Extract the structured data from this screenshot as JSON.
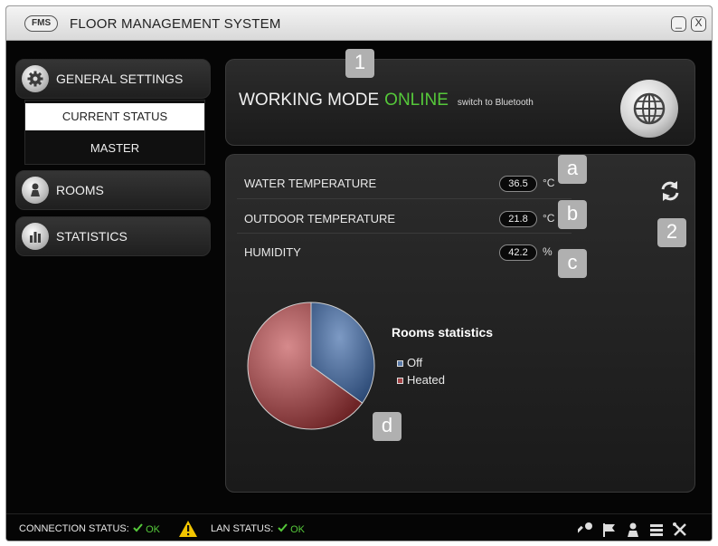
{
  "window": {
    "logo": "FMS",
    "title": "FLOOR MANAGEMENT SYSTEM",
    "minimize_glyph": "_",
    "close_glyph": "X"
  },
  "sidebar": {
    "items": [
      {
        "label": "GENERAL SETTINGS",
        "icon": "gear-icon"
      },
      {
        "label": "ROOMS",
        "icon": "room-icon"
      },
      {
        "label": "STATISTICS",
        "icon": "statistics-icon"
      }
    ],
    "submenu": [
      {
        "label": "CURRENT STATUS",
        "selected": true
      },
      {
        "label": "MASTER",
        "selected": false
      }
    ]
  },
  "mode_panel": {
    "label": "WORKING MODE",
    "status": "ONLINE",
    "switch_text": "switch to Bluetooth",
    "icon": "globe-icon"
  },
  "readings": [
    {
      "label": "WATER TEMPERATURE",
      "value": "36.5",
      "unit": "°C"
    },
    {
      "label": "OUTDOOR TEMPERATURE",
      "value": "21.8",
      "unit": "°C"
    },
    {
      "label": "HUMIDITY",
      "value": "42.2",
      "unit": "%"
    }
  ],
  "refresh_icon": "refresh-icon",
  "markers": {
    "m1": "1",
    "m2": "2",
    "a": "a",
    "b": "b",
    "c": "c",
    "d": "d"
  },
  "chart_data": {
    "type": "pie",
    "title": "Rooms statistics",
    "slices": [
      {
        "label": "Off",
        "value": 35,
        "color": "#4a6a96"
      },
      {
        "label": "Heated",
        "value": 65,
        "color": "#8c3638"
      }
    ]
  },
  "statusbar": {
    "connection_label": "CONNECTION STATUS:",
    "connection_value": "OK",
    "lan_label": "LAN STATUS:",
    "lan_value": "OK"
  },
  "colors": {
    "accent_green": "#55c83a",
    "warning_yellow": "#f2c500"
  }
}
